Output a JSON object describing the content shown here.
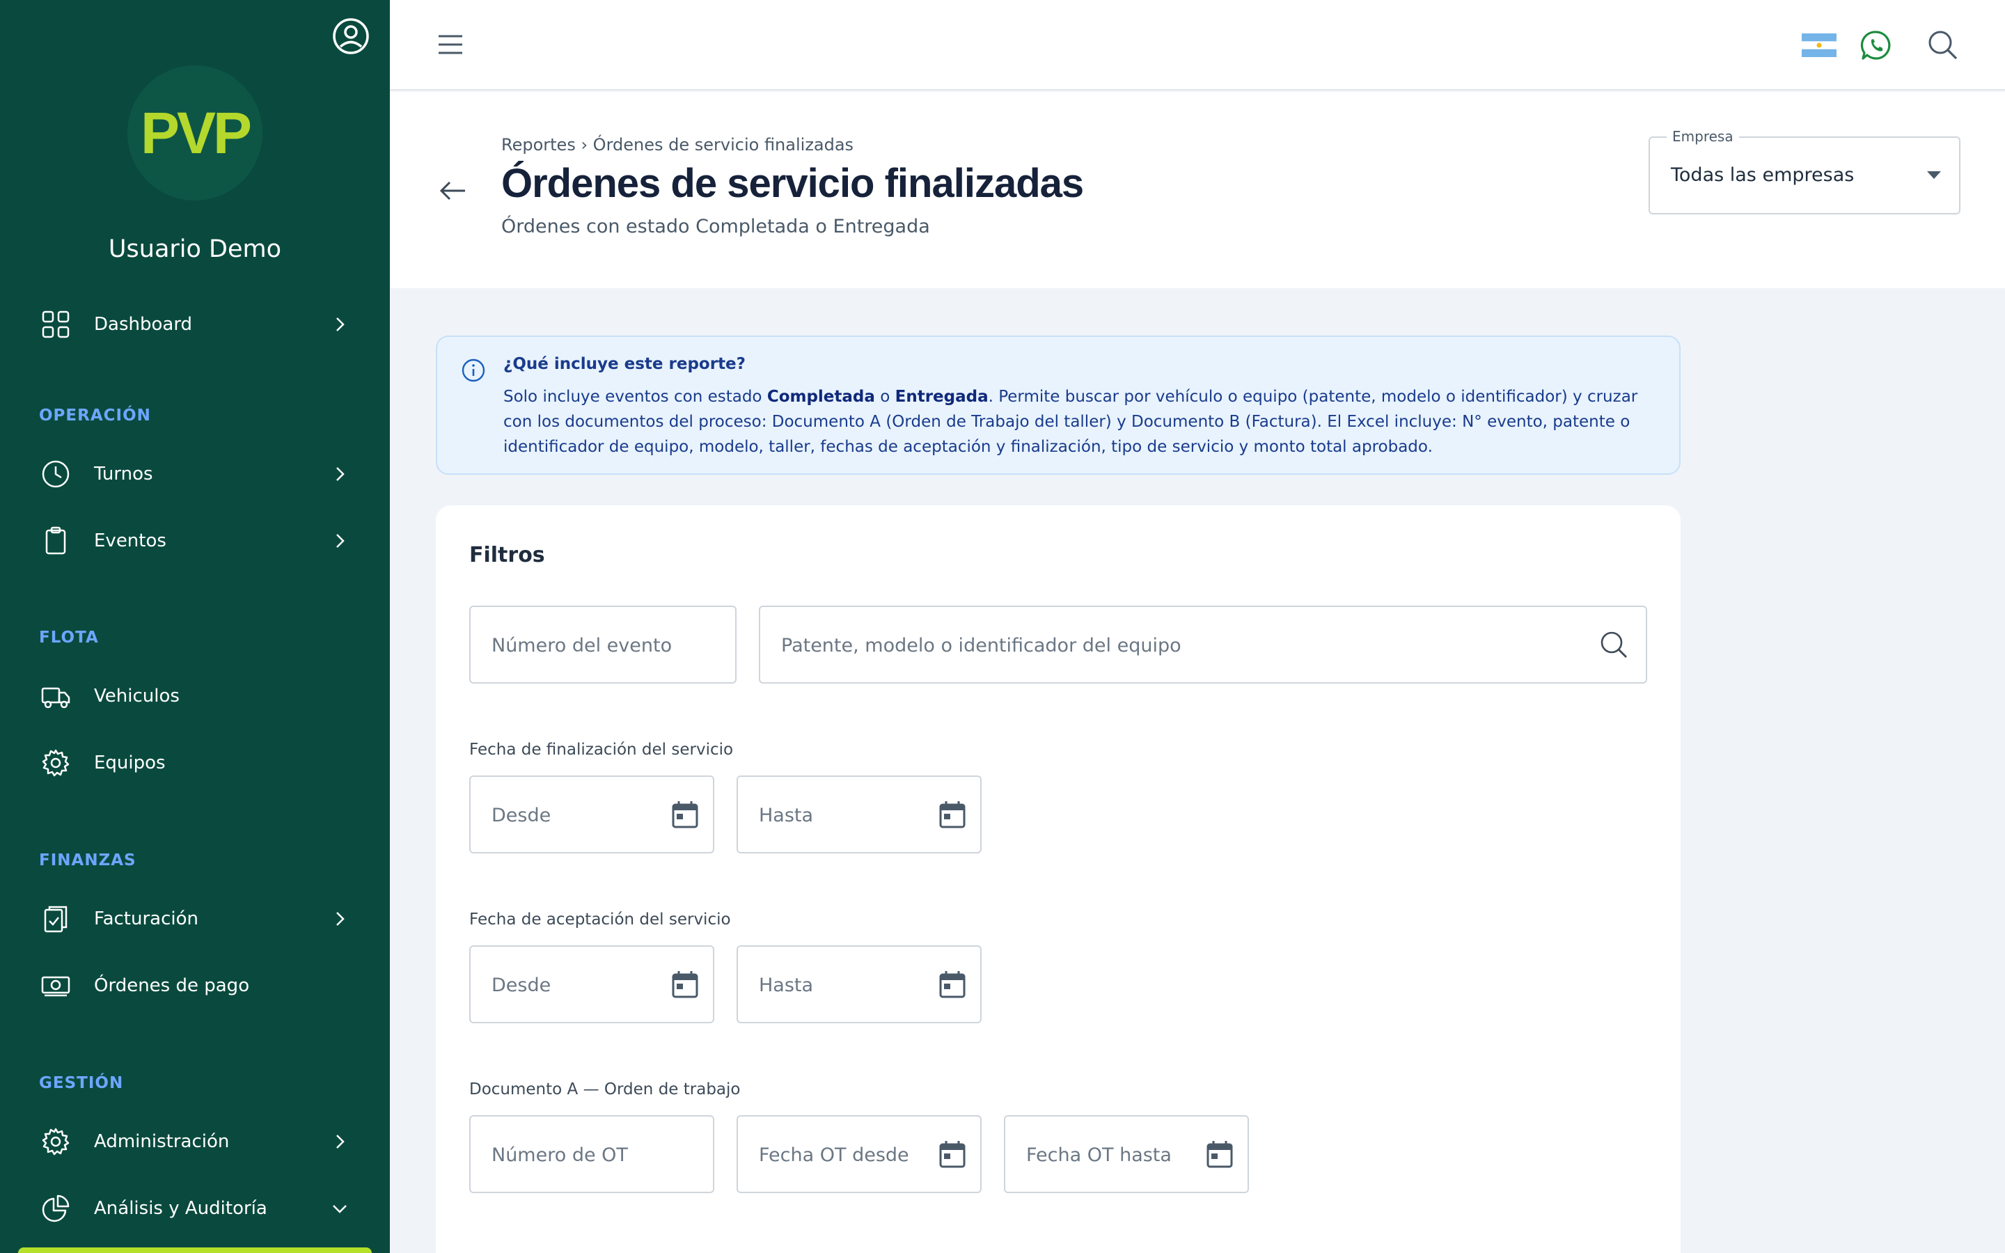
{
  "sidebar": {
    "username": "Usuario Demo",
    "logo_text": "PVP",
    "items": [
      {
        "label": "Dashboard"
      },
      {
        "label": "Turnos"
      },
      {
        "label": "Eventos"
      },
      {
        "label": "Vehiculos"
      },
      {
        "label": "Equipos"
      },
      {
        "label": "Facturación"
      },
      {
        "label": "Órdenes de pago"
      },
      {
        "label": "Administración"
      },
      {
        "label": "Análisis y Auditoría"
      }
    ],
    "sections": {
      "operacion": "OPERACIÓN",
      "flota": "FLOTA",
      "finanzas": "FINANZAS",
      "gestion": "GESTIÓN"
    }
  },
  "header": {
    "breadcrumb": "Reportes › Órdenes de servicio finalizadas",
    "title": "Órdenes de servicio finalizadas",
    "subtitle": "Órdenes con estado Completada o Entregada",
    "empresa_label": "Empresa",
    "empresa_value": "Todas las empresas"
  },
  "info": {
    "title": "¿Qué incluye este reporte?",
    "body_prefix": "Solo incluye eventos con estado ",
    "status_1": "Completada",
    "connector": " o ",
    "status_2": "Entregada",
    "body_rest": ". Permite buscar por vehículo o equipo (patente, modelo o identificador) y cruzar con los documentos del proceso: Documento A (Orden de Trabajo del taller) y Documento B (Factura). El Excel incluye: N° evento, patente o identificador de equipo, modelo, taller, fechas de aceptación y finalización, tipo de servicio y monto total aprobado."
  },
  "filters": {
    "title": "Filtros",
    "event_number_placeholder": "Número del evento",
    "vehicle_search_placeholder": "Patente, modelo o identificador del equipo",
    "finalizacion_label": "Fecha de finalización del servicio",
    "aceptacion_label": "Fecha de aceptación del servicio",
    "desde": "Desde",
    "hasta": "Hasta",
    "doc_a_label": "Documento A — Orden de trabajo",
    "ot_number": "Número de OT",
    "ot_desde": "Fecha OT desde",
    "ot_hasta": "Fecha OT hasta"
  },
  "colors": {
    "sidebar_bg": "#0a4a3e",
    "accent_green": "#b4d82c",
    "section_blue": "#6da6ff",
    "info_bg": "#e8f3fd",
    "whatsapp": "#1c8c3e"
  }
}
